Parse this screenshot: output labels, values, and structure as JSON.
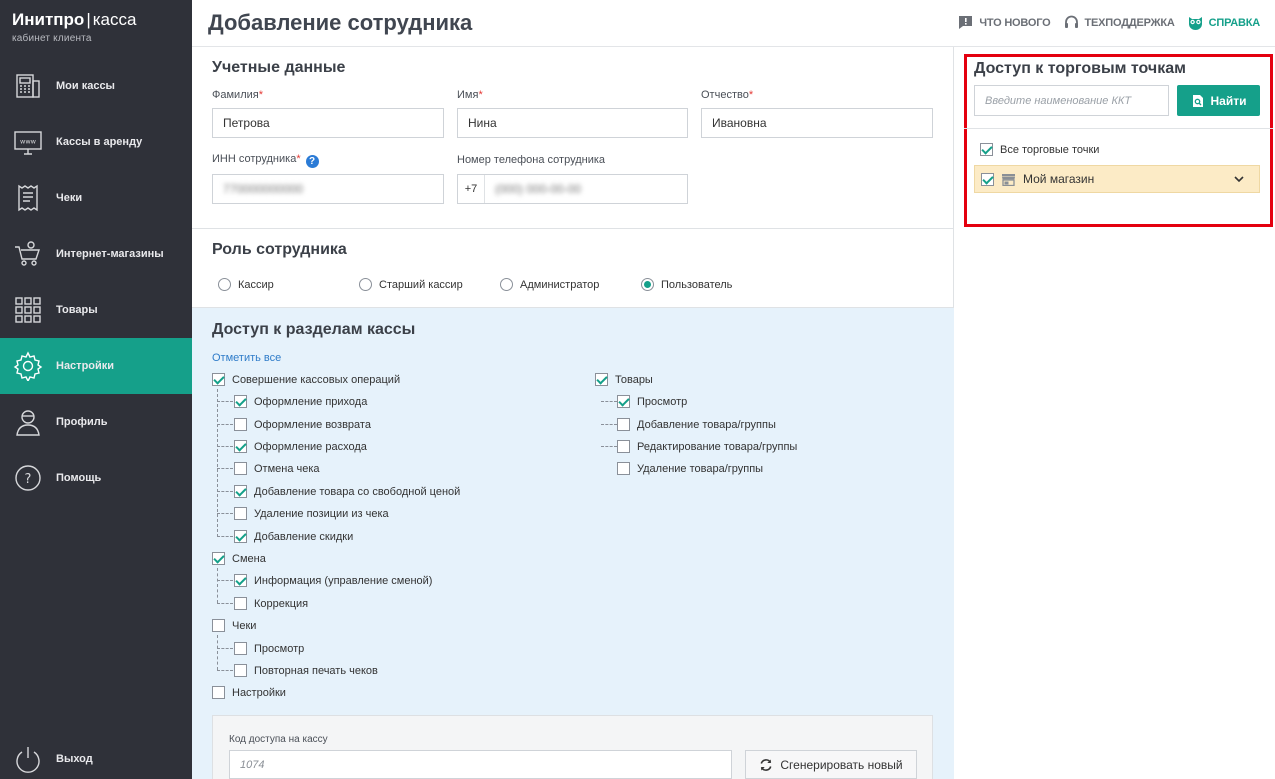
{
  "brand": {
    "name": "Инитпро",
    "separator": "|",
    "product": "касса",
    "caption": "кабинет клиента"
  },
  "sidebar": {
    "items": [
      {
        "label": "Мои кассы",
        "icon": "cash-register-icon"
      },
      {
        "label": "Кассы в аренду",
        "icon": "www-monitor-icon"
      },
      {
        "label": "Чеки",
        "icon": "receipt-icon"
      },
      {
        "label": "Интернет-магазины",
        "icon": "online-cart-icon"
      },
      {
        "label": "Товары",
        "icon": "grid-icon"
      },
      {
        "label": "Настройки",
        "icon": "gear-icon",
        "active": true
      },
      {
        "label": "Профиль",
        "icon": "user-icon"
      },
      {
        "label": "Помощь",
        "icon": "help-circle-icon"
      }
    ],
    "logout": {
      "label": "Выход",
      "icon": "power-icon"
    }
  },
  "header": {
    "title": "Добавление сотрудника",
    "links": {
      "news": "ЧТО НОВОГО",
      "support": "ТЕХПОДДЕРЖКА",
      "help": "СПРАВКА"
    }
  },
  "credentials": {
    "title": "Учетные данные",
    "last_name_label": "Фамилия",
    "last_name_value": "Петрова",
    "first_name_label": "Имя",
    "first_name_value": "Нина",
    "patronymic_label": "Отчество",
    "patronymic_value": "Ивановна",
    "inn_label": "ИНН сотрудника",
    "inn_value": "770000000000",
    "phone_label": "Номер телефона сотрудника",
    "phone_prefix": "+7",
    "phone_value": "(000) 000-00-00",
    "required_mark": "*",
    "help_mark": "?"
  },
  "role": {
    "title": "Роль сотрудника",
    "options": [
      {
        "label": "Кассир",
        "selected": false
      },
      {
        "label": "Старший кассир",
        "selected": false
      },
      {
        "label": "Администратор",
        "selected": false
      },
      {
        "label": "Пользователь",
        "selected": true
      }
    ]
  },
  "access": {
    "title": "Доступ к разделам кассы",
    "mark_all": "Отметить все",
    "left_groups": [
      {
        "label": "Совершение кассовых операций",
        "checked": true,
        "children": [
          {
            "label": "Оформление прихода",
            "checked": true
          },
          {
            "label": "Оформление возврата",
            "checked": false
          },
          {
            "label": "Оформление расхода",
            "checked": true
          },
          {
            "label": "Отмена чека",
            "checked": false
          },
          {
            "label": "Добавление товара со свободной ценой",
            "checked": true
          },
          {
            "label": "Удаление позиции из чека",
            "checked": false
          },
          {
            "label": "Добавление скидки",
            "checked": true
          }
        ]
      },
      {
        "label": "Смена",
        "checked": true,
        "children": [
          {
            "label": "Информация (управление сменой)",
            "checked": true
          },
          {
            "label": "Коррекция",
            "checked": false
          }
        ]
      },
      {
        "label": "Чеки",
        "checked": false,
        "children": [
          {
            "label": "Просмотр",
            "checked": false
          },
          {
            "label": "Повторная печать чеков",
            "checked": false
          }
        ]
      },
      {
        "label": "Настройки",
        "checked": false,
        "children": []
      }
    ],
    "right_groups": [
      {
        "label": "Товары",
        "checked": true,
        "children": [
          {
            "label": "Просмотр",
            "checked": true
          },
          {
            "label": "Добавление товара/группы",
            "checked": false
          },
          {
            "label": "Редактирование товара/группы",
            "checked": false
          },
          {
            "label": "Удаление товара/группы",
            "checked": false
          }
        ]
      }
    ],
    "code_label": "Код доступа на кассу",
    "code_placeholder": "1074",
    "generate_label": "Сгенерировать новый"
  },
  "outlets": {
    "title": "Доступ к торговым точкам",
    "search_placeholder": "Введите наименование ККТ",
    "find_label": "Найти",
    "all_label": "Все торговые точки",
    "all_checked": true,
    "shop_label": "Мой магазин",
    "shop_checked": true
  },
  "colors": {
    "accent": "#15a08a",
    "sidebar": "#2f3139",
    "highlight": "#e4000f",
    "access_bg": "#e6f2fb"
  }
}
